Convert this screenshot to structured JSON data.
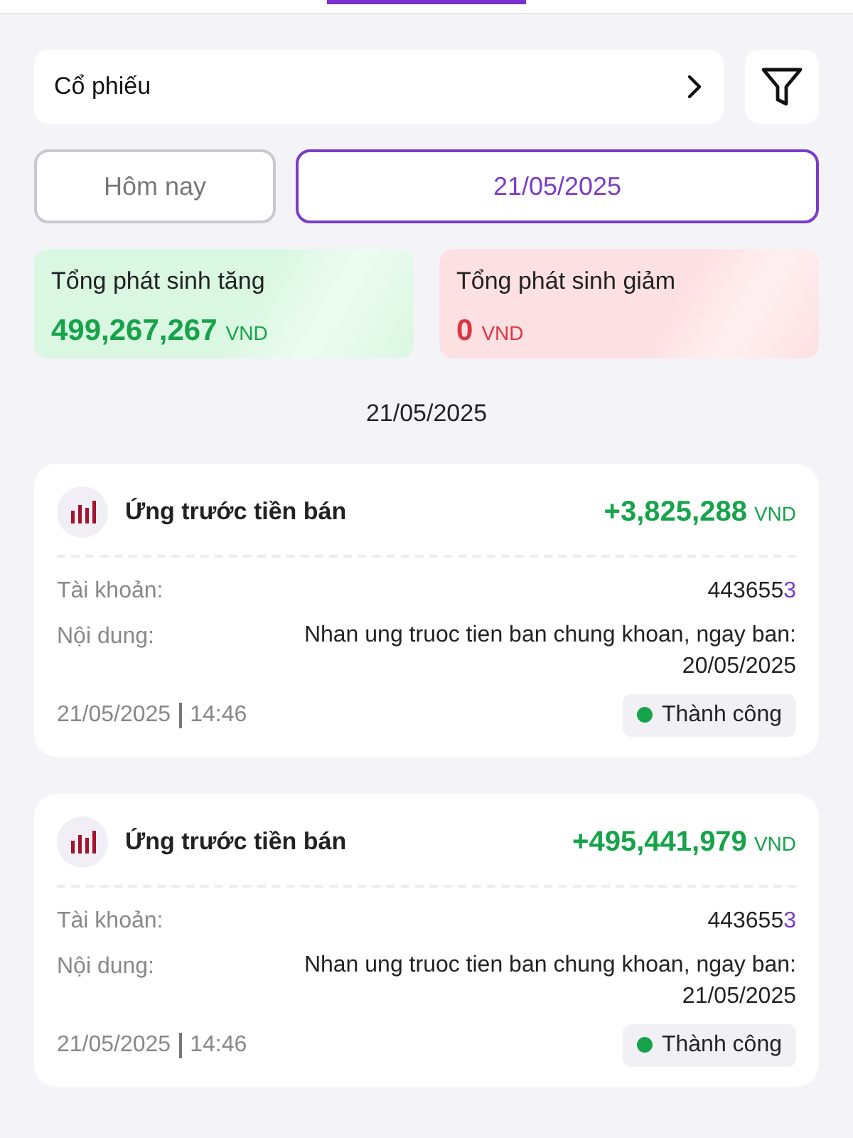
{
  "category_select": {
    "value": "Cổ phiếu"
  },
  "date_filters": [
    {
      "label": "Hôm nay",
      "selected": false
    },
    {
      "label": "21/05/2025",
      "selected": true
    }
  ],
  "summary": [
    {
      "kind": "increase",
      "label": "Tổng phát sinh tăng",
      "amount": "499,267,267",
      "currency": "VND"
    },
    {
      "kind": "decrease",
      "label": "Tổng phát sinh giảm",
      "amount": "0",
      "currency": "VND"
    }
  ],
  "group_date": "21/05/2025",
  "transactions": [
    {
      "title": "Ứng trước tiền bán",
      "amount": "+3,825,288",
      "currency": "VND",
      "account_label": "Tài khoản:",
      "account": "4436553",
      "content_label": "Nội dung:",
      "content": "Nhan ung truoc tien ban chung khoan, ngay ban: 20/05/2025",
      "date": "21/05/2025",
      "time": "14:46",
      "status": {
        "label": "Thành công",
        "color": "#16a34a"
      }
    },
    {
      "title": "Ứng trước tiền bán",
      "amount": "+495,441,979",
      "currency": "VND",
      "account_label": "Tài khoản:",
      "account": "4436553",
      "content_label": "Nội dung:",
      "content": "Nhan ung truoc tien ban chung khoan, ngay ban: 21/05/2025",
      "date": "21/05/2025",
      "time": "14:46",
      "status": {
        "label": "Thành công",
        "color": "#16a34a"
      }
    }
  ]
}
